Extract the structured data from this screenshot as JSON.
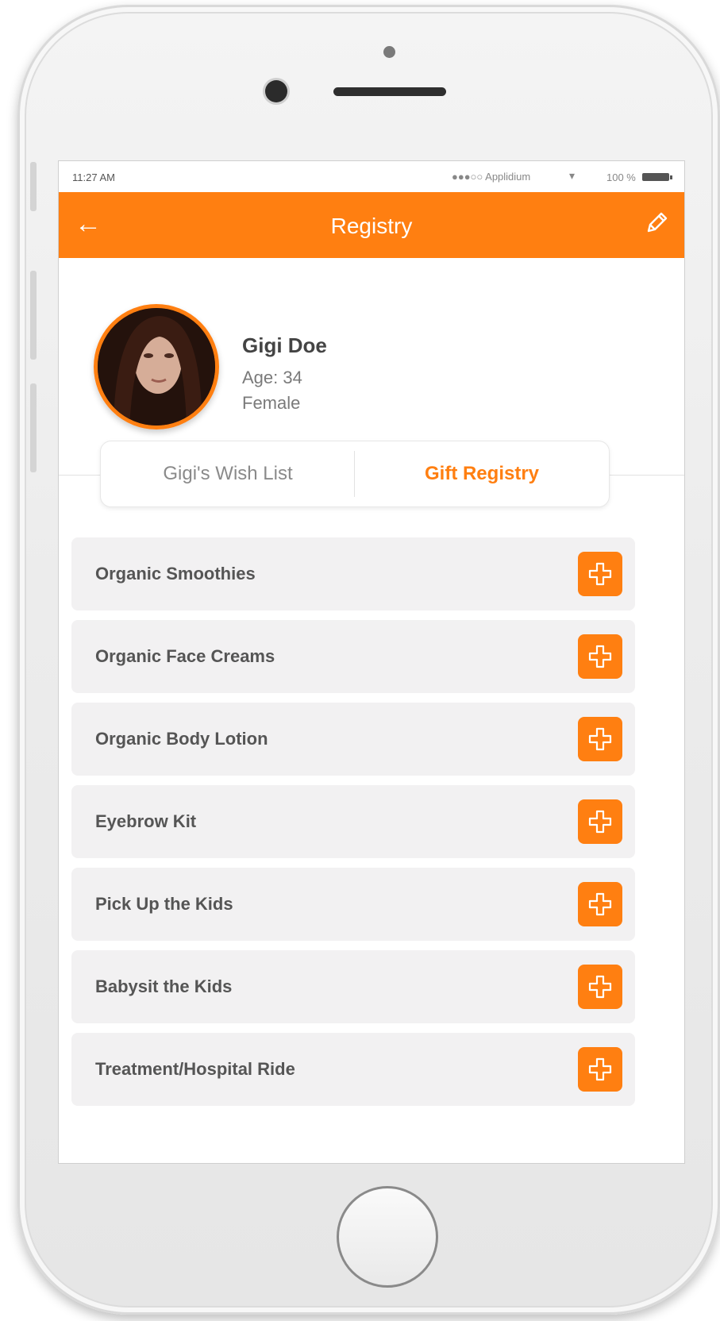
{
  "status_bar": {
    "time": "11:27 AM",
    "carrier": "●●●○○ Applidium",
    "wifi_icon": "wifi-icon",
    "battery_text": "100 %"
  },
  "app_bar": {
    "title": "Registry",
    "back_icon": "arrow-left-icon",
    "edit_icon": "pencil-icon",
    "background_color": "#ff7f11"
  },
  "profile": {
    "name": "Gigi Doe",
    "age": "Age: 34",
    "gender": "Female"
  },
  "tabs": [
    {
      "label": "Gigi's Wish List",
      "active": false
    },
    {
      "label": "Gift Registry",
      "active": true
    }
  ],
  "items": [
    {
      "label": "Organic Smoothies"
    },
    {
      "label": "Organic Face Creams"
    },
    {
      "label": "Organic Body Lotion"
    },
    {
      "label": "Eyebrow Kit"
    },
    {
      "label": "Pick Up the Kids"
    },
    {
      "label": "Babysit the Kids"
    },
    {
      "label": "Treatment/Hospital Ride"
    }
  ],
  "colors": {
    "accent": "#ff7f11",
    "item_bg": "#f2f1f2"
  }
}
